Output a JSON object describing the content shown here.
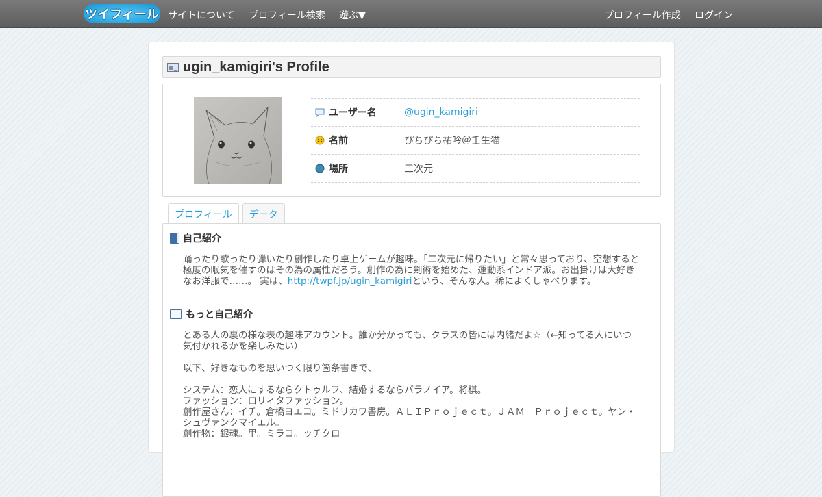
{
  "nav": {
    "logo_text": "ツイフィール",
    "left_items": [
      "サイトについて",
      "プロフィール検索",
      "遊ぶ▼"
    ],
    "right_items": [
      "プロフィール作成",
      "ログイン"
    ]
  },
  "page_title": "ugin_kamigiri's Profile",
  "profile": {
    "rows": [
      {
        "label": "ユーザー名",
        "value": "@ugin_kamigiri",
        "icon": "speech-bubble-icon"
      },
      {
        "label": "名前",
        "value": "ぴちぴち祐吟＠壬生猫",
        "icon": "smiley-icon"
      },
      {
        "label": "場所",
        "value": "三次元",
        "icon": "globe-icon"
      }
    ]
  },
  "tabs": [
    "プロフィール",
    "データ"
  ],
  "sections": {
    "intro": {
      "title": "自己紹介",
      "text_before": "踊ったり歌ったり弾いたり創作したり卓上ゲームが趣味。「二次元に帰りたい」と常々思っており、空想すると極度の眠気を催すのはその為の属性だろう。創作の為に剣術を始めた、運動系インドア派。お出掛けは大好きなお洋服で……。 実は、",
      "link": "http://twpf.jp/ugin_kamigiri",
      "text_after": "という、そんな人。稀によくしゃべります。"
    },
    "more": {
      "title": "もっと自己紹介",
      "paragraphs": [
        "とある人の裏の様な表の趣味アカウント。誰か分かっても、クラスの皆には内緒だよ☆（←知ってる人にいつ気付かれるかを楽しみたい）",
        "以下、好きなものを思いつく限り箇条書きで、",
        "システム：恋人にするならクトゥルフ、結婚するならパラノイア。将棋。\nファッション：ロリィタファッション。\n創作屋さん：イチ。倉橋ヨエコ。ミドリカワ書房。ＡＬＩＰｒｏｊｅｃｔ。ＪＡＭ　Ｐｒｏｊｅｃｔ。ヤン・シュヴァンクマイエル。\n創作物：銀魂。里。ミラコ。ッチクロ"
      ]
    }
  }
}
